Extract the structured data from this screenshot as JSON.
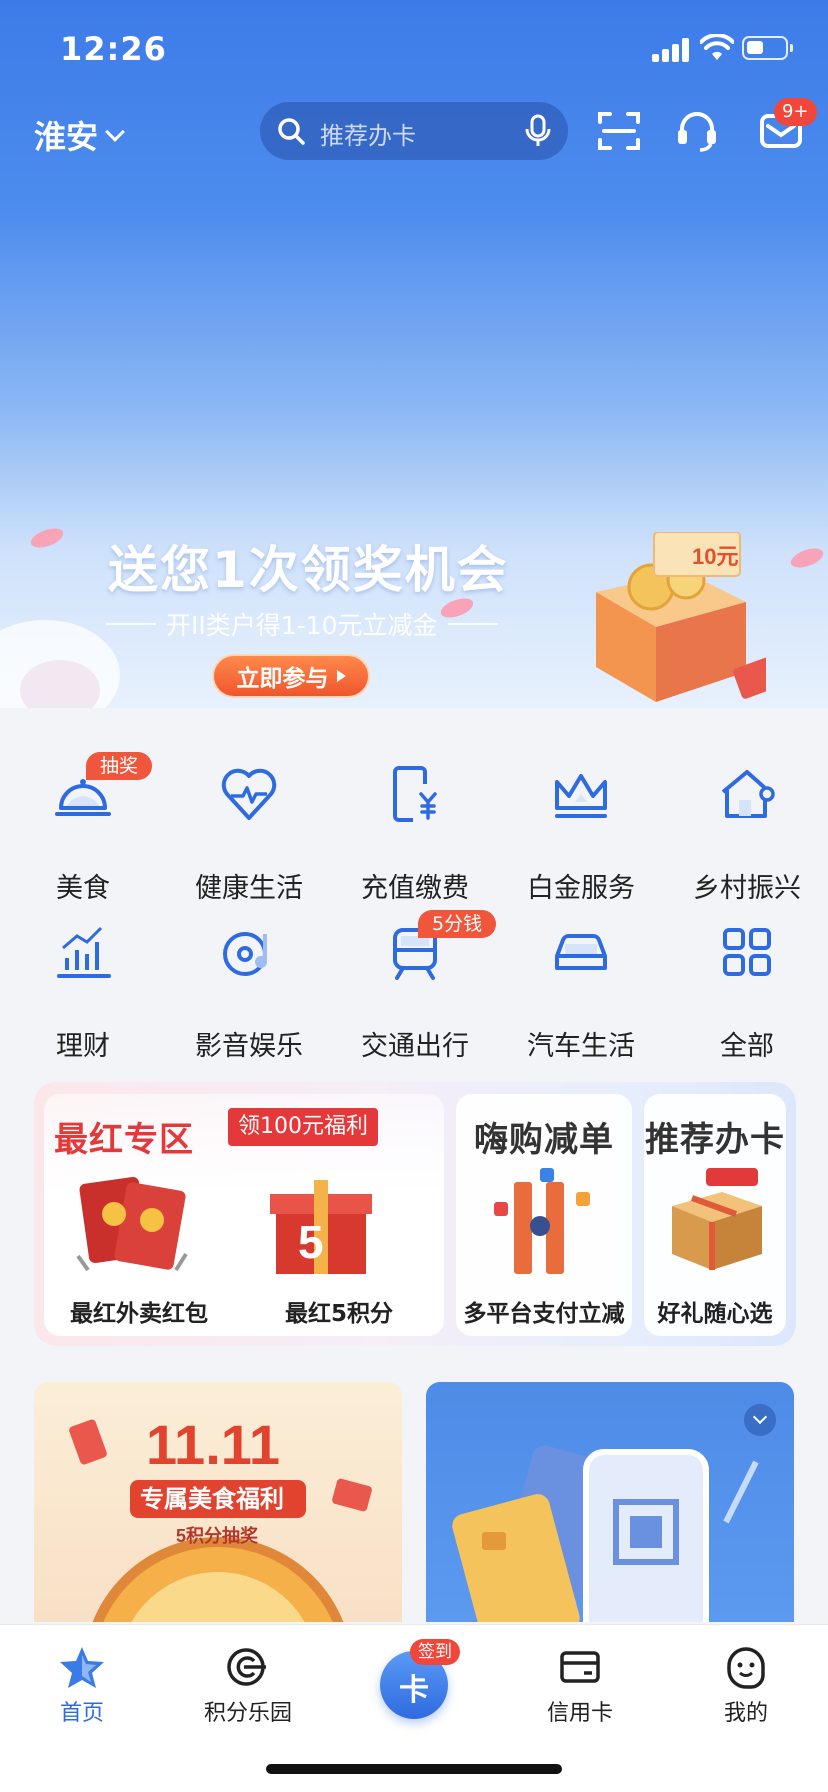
{
  "status_bar": {
    "time": "12:26"
  },
  "header": {
    "city": "淮安",
    "search_placeholder": "推荐办卡",
    "message_badge": "9+"
  },
  "banner": {
    "title": "送您1次领奖机会",
    "subtitle": "开II类户得1-10元立减金",
    "button": "立即参与",
    "coupon_text": "10元"
  },
  "services": [
    {
      "label": "美食",
      "icon": "dining-bell-icon",
      "tag": "抽奖"
    },
    {
      "label": "健康生活",
      "icon": "heart-pulse-icon",
      "tag": ""
    },
    {
      "label": "充值缴费",
      "icon": "phone-yuan-icon",
      "tag": ""
    },
    {
      "label": "白金服务",
      "icon": "crown-icon",
      "tag": ""
    },
    {
      "label": "乡村振兴",
      "icon": "house-icon",
      "tag": ""
    },
    {
      "label": "理财",
      "icon": "chart-bars-icon",
      "tag": ""
    },
    {
      "label": "影音娱乐",
      "icon": "music-disc-icon",
      "tag": ""
    },
    {
      "label": "交通出行",
      "icon": "train-icon",
      "tag": "5分钱"
    },
    {
      "label": "汽车生活",
      "icon": "car-icon",
      "tag": ""
    },
    {
      "label": "全部",
      "icon": "grid-icon",
      "tag": ""
    }
  ],
  "promo": {
    "zone_title": "最红专区",
    "zone_tag": "领100元福利",
    "items": [
      {
        "caption": "最红外卖红包"
      },
      {
        "caption": "最红5积分"
      }
    ],
    "shopping": {
      "title": "嗨购减单",
      "caption": "多平台支付立减"
    },
    "card": {
      "title": "推荐办卡",
      "caption": "好礼随心选"
    }
  },
  "cards": {
    "left": {
      "title": "11.11",
      "subtitle": "专属美食福利",
      "note": "5积分抽奖"
    }
  },
  "tabbar": {
    "tabs": [
      {
        "label": "首页",
        "active": true
      },
      {
        "label": "积分乐园",
        "active": false
      },
      {
        "label": "签到",
        "active": false
      },
      {
        "label": "信用卡",
        "active": false
      },
      {
        "label": "我的",
        "active": false
      }
    ],
    "center_text": "卡",
    "sign_badge": "签到"
  },
  "colors": {
    "accent": "#2f6be0",
    "badge": "#f1473b",
    "promo_red": "#e23a3a"
  }
}
